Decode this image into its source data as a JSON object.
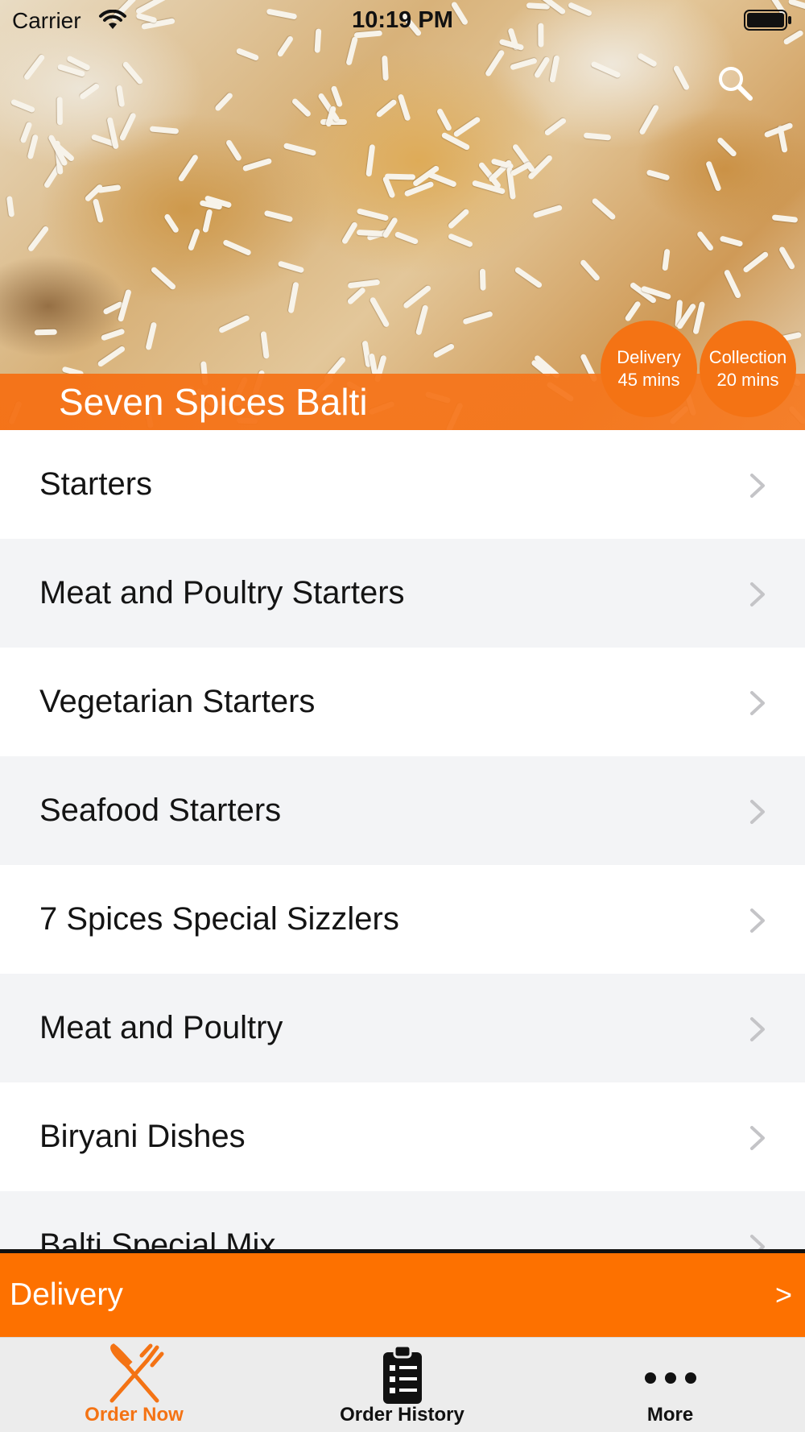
{
  "status_bar": {
    "carrier": "Carrier",
    "time": "10:19 PM"
  },
  "header": {
    "restaurant_name": "Seven Spices Balti",
    "delivery_time": {
      "label": "Delivery",
      "value": "45 mins"
    },
    "collection_time": {
      "label": "Collection",
      "value": "20 mins"
    },
    "search_icon": "search-icon"
  },
  "menu": {
    "categories": [
      {
        "label": "Starters"
      },
      {
        "label": "Meat and Poultry Starters"
      },
      {
        "label": "Vegetarian Starters"
      },
      {
        "label": "Seafood Starters"
      },
      {
        "label": "7 Spices Special Sizzlers"
      },
      {
        "label": "Meat and Poultry"
      },
      {
        "label": "Biryani Dishes"
      },
      {
        "label": "Balti Special Mix"
      }
    ]
  },
  "order_bar": {
    "mode": "Delivery",
    "arrow": ">"
  },
  "tab_bar": {
    "tabs": [
      {
        "label": "Order Now",
        "icon": "fork-knife-icon",
        "active": true
      },
      {
        "label": "Order History",
        "icon": "clipboard-list-icon",
        "active": false
      },
      {
        "label": "More",
        "icon": "more-dots-icon",
        "active": false
      }
    ]
  },
  "colors": {
    "accent": "#f47314",
    "order_bar": "#fd7100",
    "row_alt": "#f3f4f6",
    "tab_bar_bg": "#ececec"
  }
}
